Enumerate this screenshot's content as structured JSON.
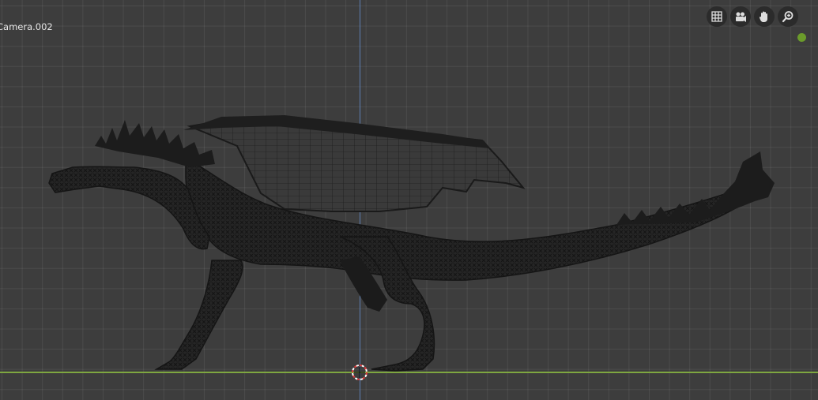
{
  "viewport": {
    "camera_label": "Camera.002",
    "colors": {
      "background": "#3d3d3d",
      "grid": "#4a4a4a",
      "z_axis": "#5d7fb3",
      "x_axis": "#7ea640",
      "mesh": "#1a1a1a"
    }
  },
  "navigation": {
    "buttons": [
      {
        "name": "toggle-grid",
        "icon": "grid-icon"
      },
      {
        "name": "camera-view",
        "icon": "camera-icon"
      },
      {
        "name": "pan-view",
        "icon": "hand-icon"
      },
      {
        "name": "zoom-view",
        "icon": "zoom-icon"
      }
    ]
  },
  "model": {
    "icon": "dragon-wireframe"
  }
}
